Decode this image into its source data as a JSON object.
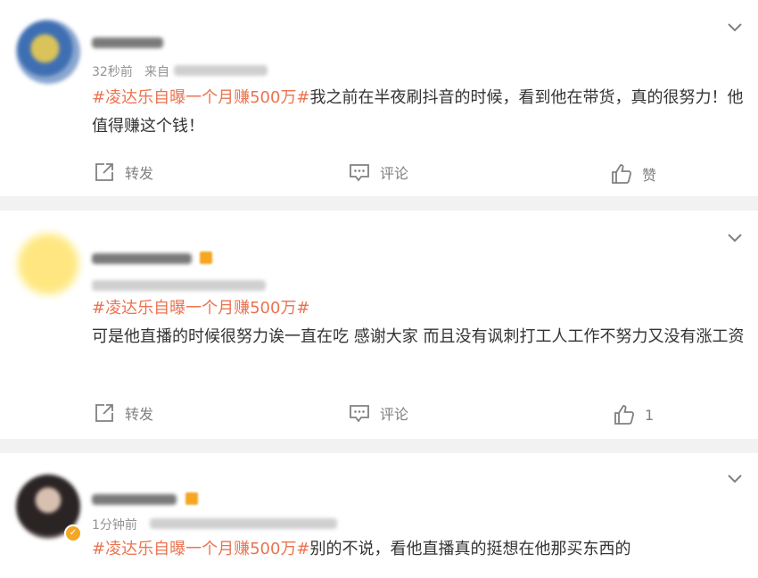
{
  "comments": [
    {
      "time": "32秒前",
      "source_prefix": "来自",
      "hashtag": "#凌达乐自曝一个月赚500万#",
      "text": "我之前在半夜刷抖音的时候，看到他在带货，真的很努力！他值得赚这个钱！",
      "repost_label": "转发",
      "comment_label": "评论",
      "like_label": "赞"
    },
    {
      "hashtag": "#凌达乐自曝一个月赚500万#",
      "text": "可是他直播的时候很努力诶一直在吃 感谢大家 而且没有讽刺打工人工作不努力又没有涨工资",
      "repost_label": "转发",
      "comment_label": "评论",
      "like_label": "1"
    },
    {
      "time": "1分钟前",
      "hashtag": "#凌达乐自曝一个月赚500万#",
      "text": "别的不说，看他直播真的挺想在他那买东西的"
    }
  ],
  "icons": {
    "chevron": "chevron-down-icon",
    "repost": "repost-icon",
    "comment": "comment-icon",
    "like": "thumbs-up-icon"
  },
  "colors": {
    "hashtag": "#eb7350",
    "meta": "#939393",
    "background": "#f2f2f2"
  }
}
